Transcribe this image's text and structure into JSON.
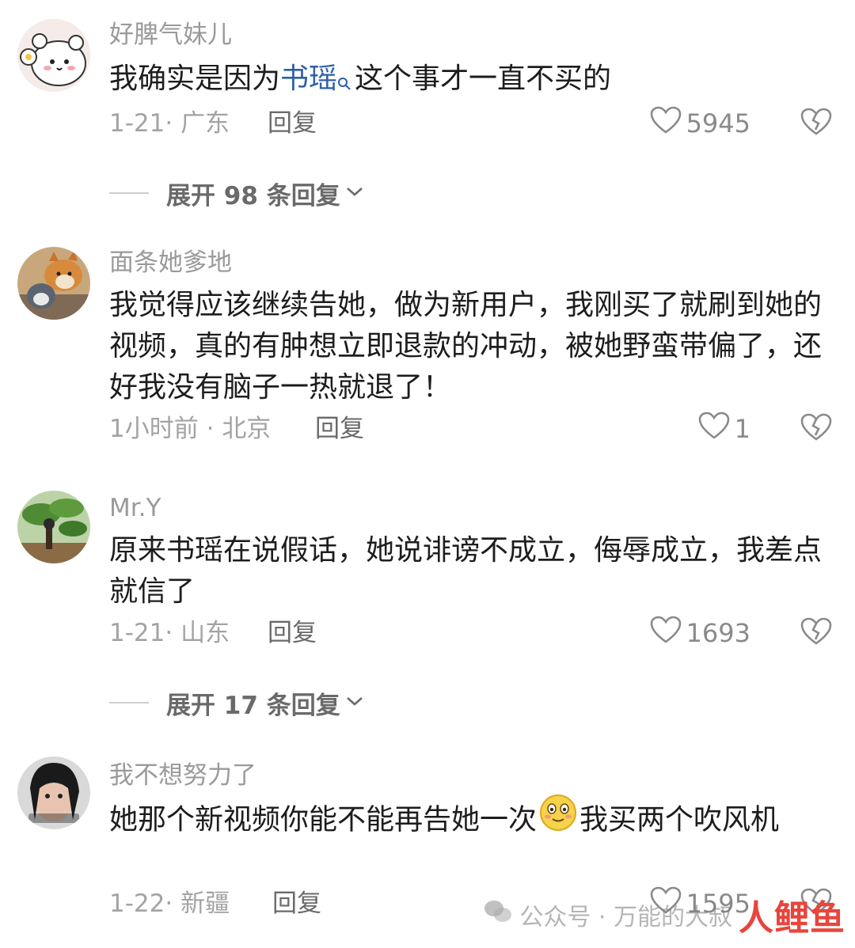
{
  "comments": [
    {
      "name": "好脾气妹儿",
      "text_parts": [
        "我确实是因为",
        "书瑶",
        "这个事才一直不买的"
      ],
      "date": "1-21",
      "location": "广东",
      "reply_label": "回复",
      "likes": "5945",
      "expand_label": "展开 98 条回复"
    },
    {
      "name": "面条她爹地",
      "text": "我觉得应该继续告她，做为新用户，我刚买了就刷到她的视频，真的有肿想立即退款的冲动，被她野蛮带偏了，还好我没有脑子一热就退了！",
      "date": "1小时前",
      "location": "北京",
      "reply_label": "回复",
      "likes": "1"
    },
    {
      "name": "Mr.Y",
      "text": "原来书瑶在说假话，她说诽谤不成立，侮辱成立，我差点就信了",
      "date": "1-21",
      "location": "山东",
      "reply_label": "回复",
      "likes": "1693",
      "expand_label": "展开 17 条回复"
    },
    {
      "name": "我不想努力了",
      "text_parts": [
        "她那个新视频你能不能再告她一次",
        "我买两个吹风机"
      ],
      "date": "1-22",
      "location": "新疆",
      "reply_label": "回复",
      "likes": "1595"
    }
  ],
  "meta_separator": "·",
  "watermark": {
    "text": "公众号 · 万能的大叔",
    "logo_text": "人鲤鱼"
  },
  "icons": {
    "like": "heart-outline-icon",
    "dislike": "broken-heart-icon",
    "expand": "chevron-down-icon",
    "search": "search-icon",
    "emoji": "smiling-face-emoji-icon",
    "wechat": "wechat-icon"
  },
  "colors": {
    "name": "#9a9a9a",
    "text": "#1d1d1d",
    "link": "#2d5fa8",
    "meta": "#a3a3a3"
  }
}
